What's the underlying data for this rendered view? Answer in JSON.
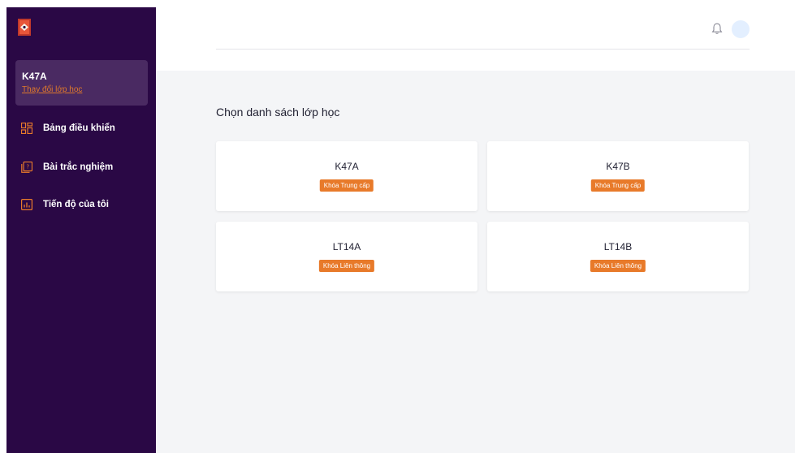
{
  "sidebar": {
    "logo_icon": "book-logo-icon",
    "current_class": {
      "name": "K47A",
      "change_label": "Thay đổi lớp học"
    },
    "items": [
      {
        "label": "Bảng điều khiển",
        "icon": "dashboard-icon"
      },
      {
        "label": "Bài trắc nghiệm",
        "icon": "quiz-icon"
      },
      {
        "label": "Tiến độ của tôi",
        "icon": "progress-chart-icon"
      }
    ]
  },
  "header": {
    "bell_icon": "bell-icon"
  },
  "main": {
    "title": "Chọn danh sách lớp học",
    "classes": [
      {
        "name": "K47A",
        "course": "Khóa Trung cấp"
      },
      {
        "name": "K47B",
        "course": "Khóa Trung cấp"
      },
      {
        "name": "LT14A",
        "course": "Khóa Liên thông"
      },
      {
        "name": "LT14B",
        "course": "Khóa Liên thông"
      }
    ]
  },
  "colors": {
    "sidebar_bg": "#2a0845",
    "accent": "#e87a2a",
    "page_bg": "#f4f5f7"
  }
}
